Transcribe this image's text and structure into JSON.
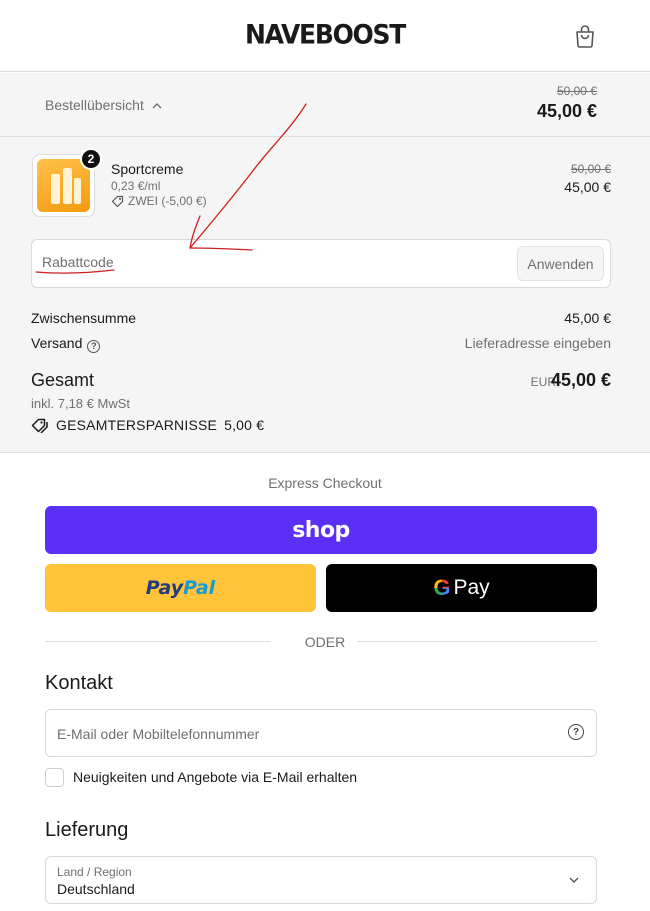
{
  "header": {
    "logo": "NAVEBOOST",
    "cart_icon": "shopping-bag-icon"
  },
  "summary_bar": {
    "toggle_label": "Bestellübersicht",
    "toggle_icon": "chevron-up-icon",
    "original_total": "50,00 €",
    "total": "45,00 €"
  },
  "line_item": {
    "quantity": "2",
    "name": "Sportcreme",
    "unit_price": "0,23 €/ml",
    "discount": "ZWEI (-5,00 €)",
    "discount_icon": "tag-icon",
    "original_price": "50,00 €",
    "price": "45,00 €"
  },
  "discount_code": {
    "placeholder": "Rabattcode",
    "apply_label": "Anwenden"
  },
  "totals": {
    "subtotal_label": "Zwischensumme",
    "subtotal_value": "45,00 €",
    "shipping_label": "Versand",
    "shipping_value": "Lieferadresse eingeben",
    "total_label": "Gesamt",
    "currency": "EUR",
    "total_value": "45,00 €",
    "tax_note": "inkl. 7,18 € MwSt",
    "savings_label": "GESAMTERSPARNISSE",
    "savings_value": "5,00 €"
  },
  "express": {
    "title": "Express Checkout",
    "shop_label": "shop",
    "paypal_part1": "Pay",
    "paypal_part2": "Pal",
    "gpay_g": "G",
    "gpay_label": "Pay",
    "divider": "ODER",
    "brand_colors": {
      "shop": "#5a31f4",
      "paypal": "#ffc439",
      "gpay": "#000000"
    }
  },
  "contact": {
    "heading": "Kontakt",
    "email_placeholder": "E-Mail oder Mobiltelefonnummer",
    "newsletter_label": "Neuigkeiten und Angebote via E-Mail erhalten",
    "newsletter_checked": false
  },
  "delivery": {
    "heading": "Lieferung",
    "country_label": "Land / Region",
    "country_value": "Deutschland"
  },
  "annotation": {
    "color": "#cc1f1f",
    "type": "hand-drawn arrow pointing to discount code field"
  }
}
